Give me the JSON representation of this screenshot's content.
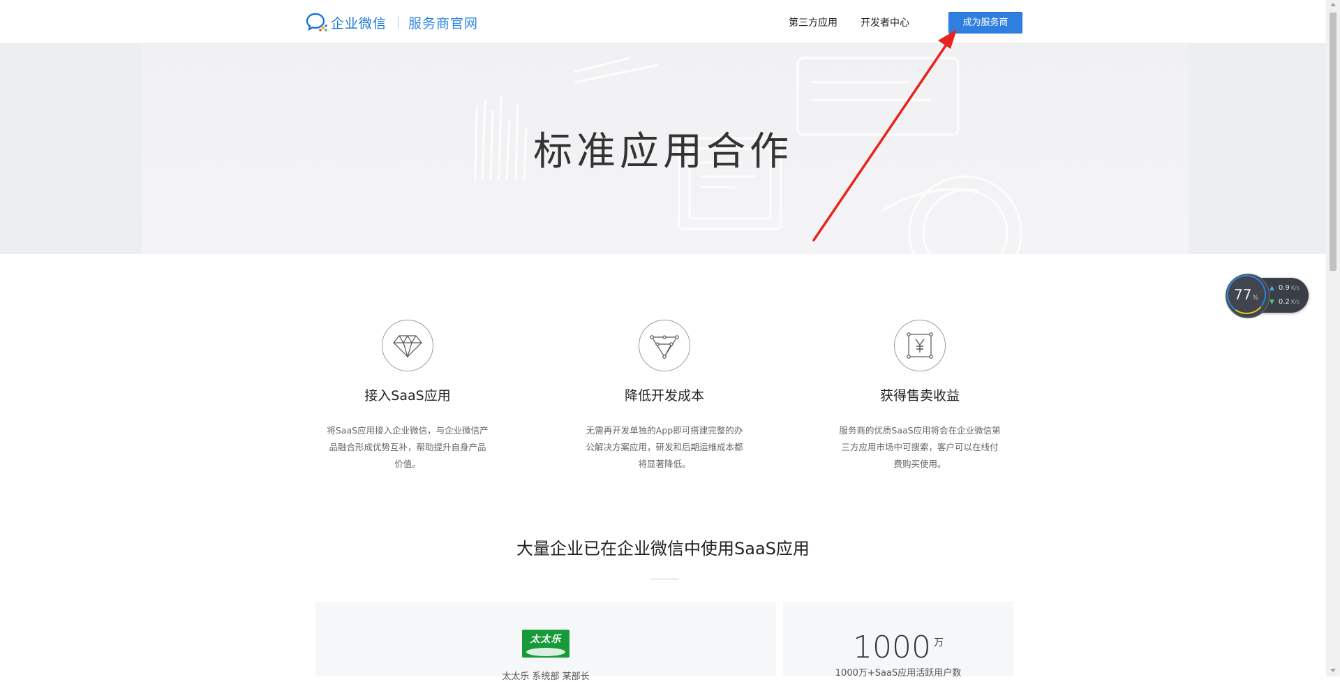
{
  "header": {
    "logo_main": "企业微信",
    "logo_sub": "服务商官网",
    "nav": [
      "第三方应用",
      "开发者中心"
    ],
    "cta_label": "成为服务商",
    "brand_color": "#2e7fe0"
  },
  "hero": {
    "title": "标准应用合作"
  },
  "features": [
    {
      "icon": "diamond-icon",
      "title": "接入SaaS应用",
      "desc_lines": [
        "将SaaS应用接入企业微信，与企业微信产",
        "品融合形成优势互补，帮助提升自身产品",
        "价值。"
      ]
    },
    {
      "icon": "funnel-network-icon",
      "title": "降低开发成本",
      "desc_lines": [
        "无需再开发单独的App即可搭建完整的办",
        "公解决方案应用，研发和后期运维成本都",
        "将显著降低。"
      ]
    },
    {
      "icon": "yuan-frame-icon",
      "title": "获得售卖收益",
      "desc_lines": [
        "服务商的优质SaaS应用将会在企业微信第",
        "三方应用市场中可搜索，客户可以在线付",
        "费购买使用。"
      ]
    }
  ],
  "usage": {
    "title": "大量企业已在企业微信中使用SaaS应用",
    "testimonial": {
      "logo_text": "太太乐",
      "caption": "太太乐 系统部 某部长"
    },
    "stat": {
      "number": "1000",
      "unit": "万",
      "caption": "1000万+SaaS应用活跃用户数"
    }
  },
  "net_widget": {
    "percent": "77",
    "percent_sign": "%",
    "up": "0.9",
    "down": "0.2",
    "unit": "K/s"
  },
  "annotation_color": "#e8231c"
}
